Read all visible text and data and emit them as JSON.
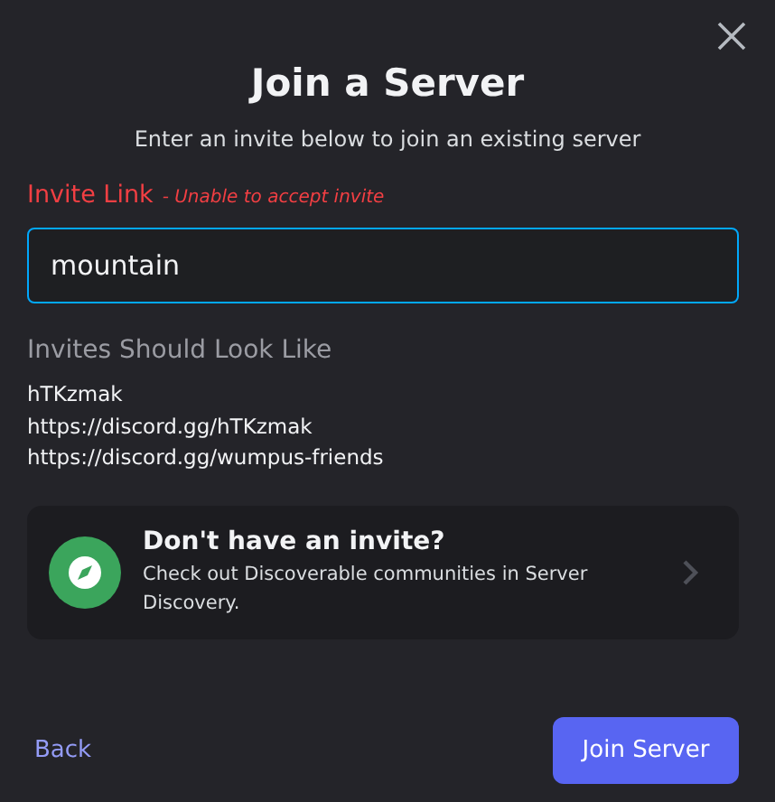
{
  "dialog": {
    "title": "Join a Server",
    "subtitle": "Enter an invite below to join an existing server"
  },
  "invite_field": {
    "label": "Invite Link",
    "error": "- Unable to accept invite",
    "value": "mountain",
    "focused": true
  },
  "examples": {
    "heading": "Invites Should Look Like",
    "items": [
      "hTKzmak",
      "https://discord.gg/hTKzmak",
      "https://discord.gg/wumpus-friends"
    ]
  },
  "discovery_card": {
    "title": "Don't have an invite?",
    "description": "Check out Discoverable communities in Server Discovery."
  },
  "footer": {
    "back": "Back",
    "join": "Join Server"
  }
}
